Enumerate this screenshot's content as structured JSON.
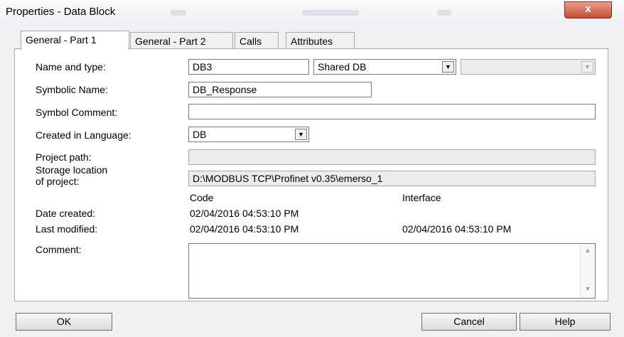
{
  "window": {
    "title": "Properties - Data Block",
    "close_label": "x"
  },
  "tabs": [
    {
      "label": "General - Part 1"
    },
    {
      "label": "General - Part 2"
    },
    {
      "label": "Calls"
    },
    {
      "label": "Attributes"
    }
  ],
  "form": {
    "name_type_label": "Name and type:",
    "name_value": "DB3",
    "type_value": "Shared DB",
    "type2_value": "",
    "symbolic_name_label": "Symbolic Name:",
    "symbolic_name_value": "DB_Response",
    "symbol_comment_label": "Symbol Comment:",
    "symbol_comment_value": "",
    "language_label": "Created in Language:",
    "language_value": "DB",
    "project_path_label": "Project path:",
    "project_path_value": "",
    "storage_label_1": "Storage location",
    "storage_label_2": "of project:",
    "storage_value": "D:\\MODBUS TCP\\Profinet v0.35\\emerso_1",
    "code_header": "Code",
    "interface_header": "Interface",
    "date_created_label": "Date created:",
    "date_created_code": "02/04/2016 04:53:10 PM",
    "last_modified_label": "Last modified:",
    "last_modified_code": "02/04/2016 04:53:10 PM",
    "last_modified_interface": "02/04/2016 04:53:10 PM",
    "comment_label": "Comment:",
    "comment_value": ""
  },
  "buttons": {
    "ok": "OK",
    "cancel": "Cancel",
    "help": "Help"
  },
  "icons": {
    "dropdown": "dropdown-arrow-icon",
    "scroll_up": "scroll-up-icon",
    "scroll_down": "scroll-down-icon"
  }
}
